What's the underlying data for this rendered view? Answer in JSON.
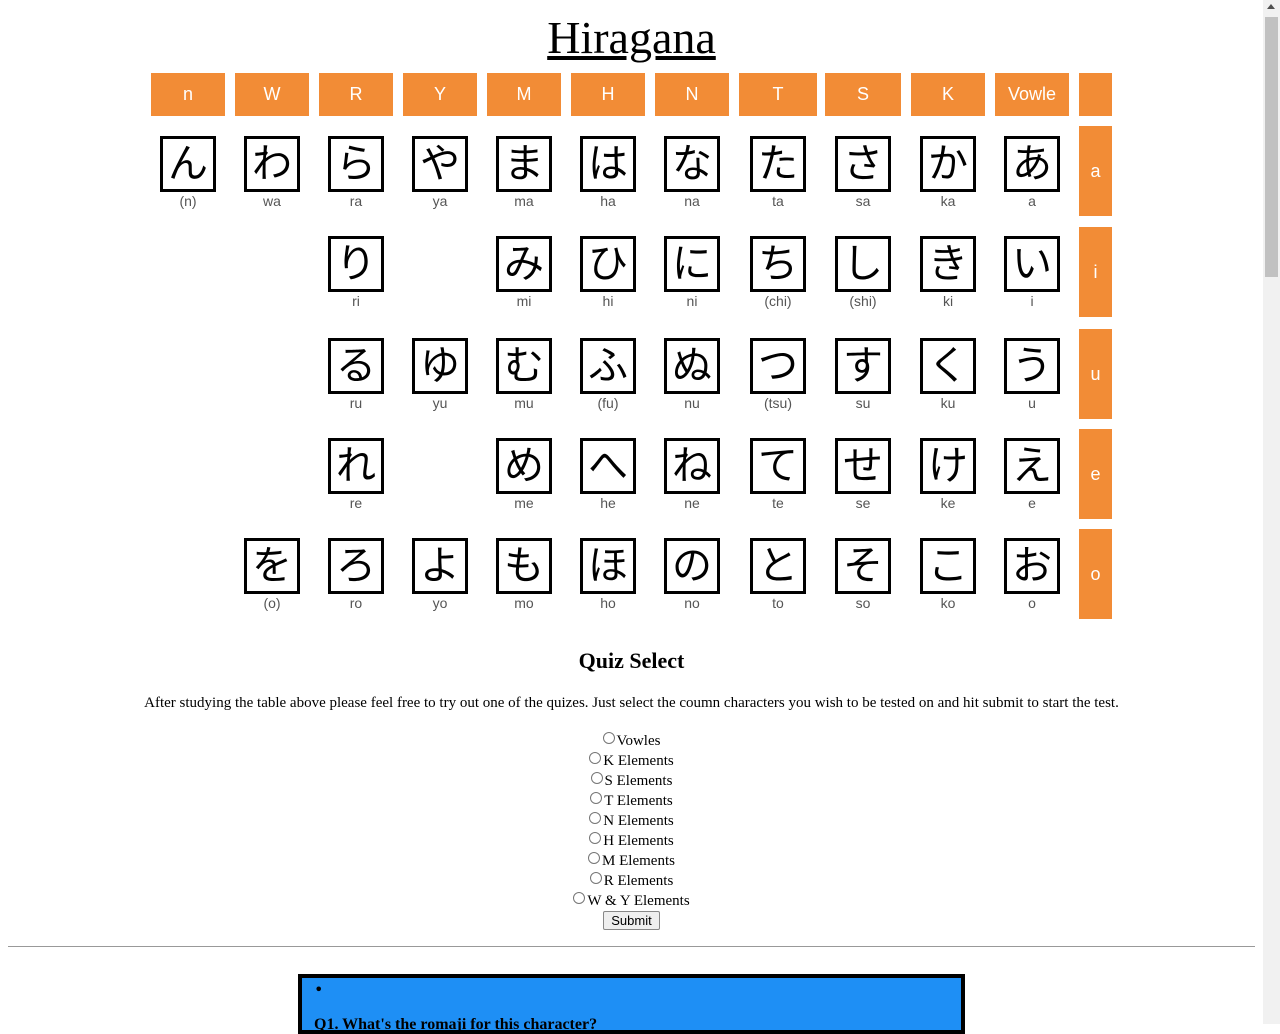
{
  "title": "Hiragana",
  "columns": [
    "n",
    "W",
    "R",
    "Y",
    "M",
    "H",
    "N",
    "T",
    "S",
    "K",
    "Vowle"
  ],
  "vowels": [
    "a",
    "i",
    "u",
    "e",
    "o"
  ],
  "rows": [
    [
      {
        "kana": "ん",
        "romaji": "(n)"
      },
      {
        "kana": "わ",
        "romaji": "wa"
      },
      {
        "kana": "ら",
        "romaji": "ra"
      },
      {
        "kana": "や",
        "romaji": "ya"
      },
      {
        "kana": "ま",
        "romaji": "ma"
      },
      {
        "kana": "は",
        "romaji": "ha"
      },
      {
        "kana": "な",
        "romaji": "na"
      },
      {
        "kana": "た",
        "romaji": "ta"
      },
      {
        "kana": "さ",
        "romaji": "sa"
      },
      {
        "kana": "か",
        "romaji": "ka"
      },
      {
        "kana": "あ",
        "romaji": "a"
      }
    ],
    [
      null,
      null,
      {
        "kana": "り",
        "romaji": "ri"
      },
      null,
      {
        "kana": "み",
        "romaji": "mi"
      },
      {
        "kana": "ひ",
        "romaji": "hi"
      },
      {
        "kana": "に",
        "romaji": "ni"
      },
      {
        "kana": "ち",
        "romaji": "(chi)"
      },
      {
        "kana": "し",
        "romaji": "(shi)"
      },
      {
        "kana": "き",
        "romaji": "ki"
      },
      {
        "kana": "い",
        "romaji": "i"
      }
    ],
    [
      null,
      null,
      {
        "kana": "る",
        "romaji": "ru"
      },
      {
        "kana": "ゆ",
        "romaji": "yu"
      },
      {
        "kana": "む",
        "romaji": "mu"
      },
      {
        "kana": "ふ",
        "romaji": "(fu)"
      },
      {
        "kana": "ぬ",
        "romaji": "nu"
      },
      {
        "kana": "つ",
        "romaji": "(tsu)"
      },
      {
        "kana": "す",
        "romaji": "su"
      },
      {
        "kana": "く",
        "romaji": "ku"
      },
      {
        "kana": "う",
        "romaji": "u"
      }
    ],
    [
      null,
      null,
      {
        "kana": "れ",
        "romaji": "re"
      },
      null,
      {
        "kana": "め",
        "romaji": "me"
      },
      {
        "kana": "へ",
        "romaji": "he"
      },
      {
        "kana": "ね",
        "romaji": "ne"
      },
      {
        "kana": "て",
        "romaji": "te"
      },
      {
        "kana": "せ",
        "romaji": "se"
      },
      {
        "kana": "け",
        "romaji": "ke"
      },
      {
        "kana": "え",
        "romaji": "e"
      }
    ],
    [
      null,
      {
        "kana": "を",
        "romaji": "(o)"
      },
      {
        "kana": "ろ",
        "romaji": "ro"
      },
      {
        "kana": "よ",
        "romaji": "yo"
      },
      {
        "kana": "も",
        "romaji": "mo"
      },
      {
        "kana": "ほ",
        "romaji": "ho"
      },
      {
        "kana": "の",
        "romaji": "no"
      },
      {
        "kana": "と",
        "romaji": "to"
      },
      {
        "kana": "そ",
        "romaji": "so"
      },
      {
        "kana": "こ",
        "romaji": "ko"
      },
      {
        "kana": "お",
        "romaji": "o"
      }
    ]
  ],
  "quiz": {
    "title": "Quiz Select",
    "description": "After studying the table above please feel free to try out one of the quizes. Just select the coumn characters you wish to be tested on and hit submit to start the test.",
    "options": [
      "Vowles",
      "K Elements",
      "S Elements",
      "T Elements",
      "N Elements",
      "H Elements",
      "M Elements",
      "R Elements",
      "W & Y Elements"
    ],
    "submit_label": "Submit"
  },
  "question_box": {
    "bullet": "•",
    "question": "Q1. What's the romaji for this character?"
  },
  "colors": {
    "accent": "#f28c36",
    "question_bg": "#1e8ff5"
  }
}
